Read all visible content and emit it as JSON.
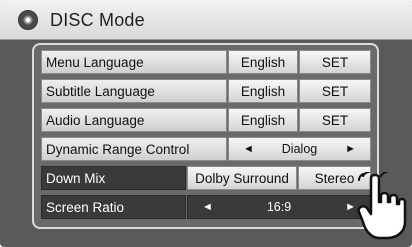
{
  "header": {
    "title": "DISC Mode",
    "icon": "disc-icon"
  },
  "rows": [
    {
      "label": "Menu Language",
      "value": "English",
      "action": "SET"
    },
    {
      "label": "Subtitle Language",
      "value": "English",
      "action": "SET"
    },
    {
      "label": "Audio Language",
      "value": "English",
      "action": "SET"
    },
    {
      "label": "Dynamic Range Control",
      "value": "Dialog"
    },
    {
      "label": "Down Mix",
      "options": [
        "Dolby Surround",
        "Stereo"
      ]
    },
    {
      "label": "Screen Ratio",
      "value": "16:9"
    }
  ],
  "icons": {
    "prev": "◄",
    "next": "►"
  }
}
